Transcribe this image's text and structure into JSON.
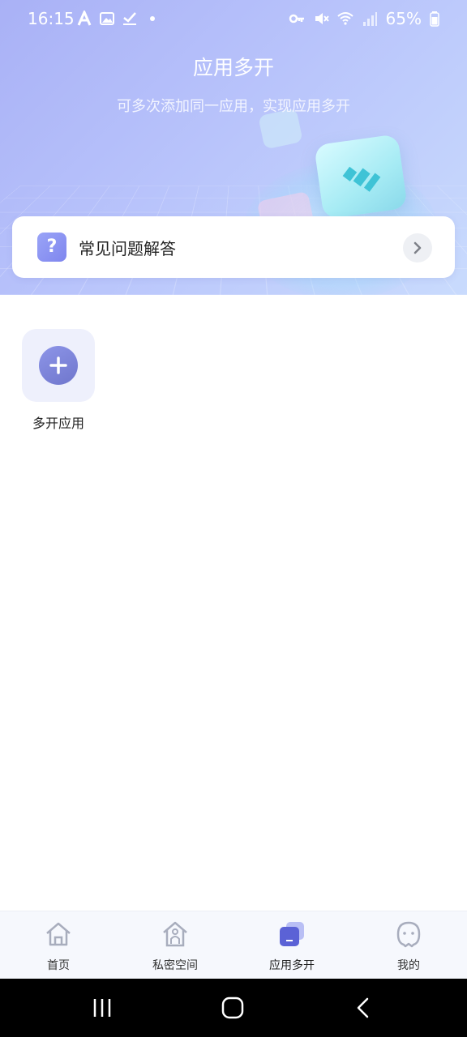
{
  "status_bar": {
    "time": "16:15",
    "battery": "65%",
    "left_icons": [
      "a-icon",
      "image-icon",
      "check-icon",
      "dot-icon"
    ],
    "right_icons": [
      "key-icon",
      "mute-icon",
      "wifi-icon",
      "signal-icon",
      "battery-icon"
    ]
  },
  "header": {
    "title": "应用多开",
    "subtitle": "可多次添加同一应用，实现应用多开"
  },
  "faq": {
    "icon_text": "?",
    "label": "常见问题解答"
  },
  "apps": [
    {
      "label": "多开应用",
      "icon": "plus-icon"
    }
  ],
  "tabbar": {
    "tabs": [
      {
        "label": "首页",
        "icon": "home-icon",
        "active": false
      },
      {
        "label": "私密空间",
        "icon": "private-house-icon",
        "active": false
      },
      {
        "label": "应用多开",
        "icon": "multi-app-icon",
        "active": true
      },
      {
        "label": "我的",
        "icon": "profile-face-icon",
        "active": false
      }
    ]
  },
  "colors": {
    "accent": "#6f76cc",
    "header_gradient_start": "#a9b1f6",
    "header_gradient_end": "#c9dbfd"
  }
}
